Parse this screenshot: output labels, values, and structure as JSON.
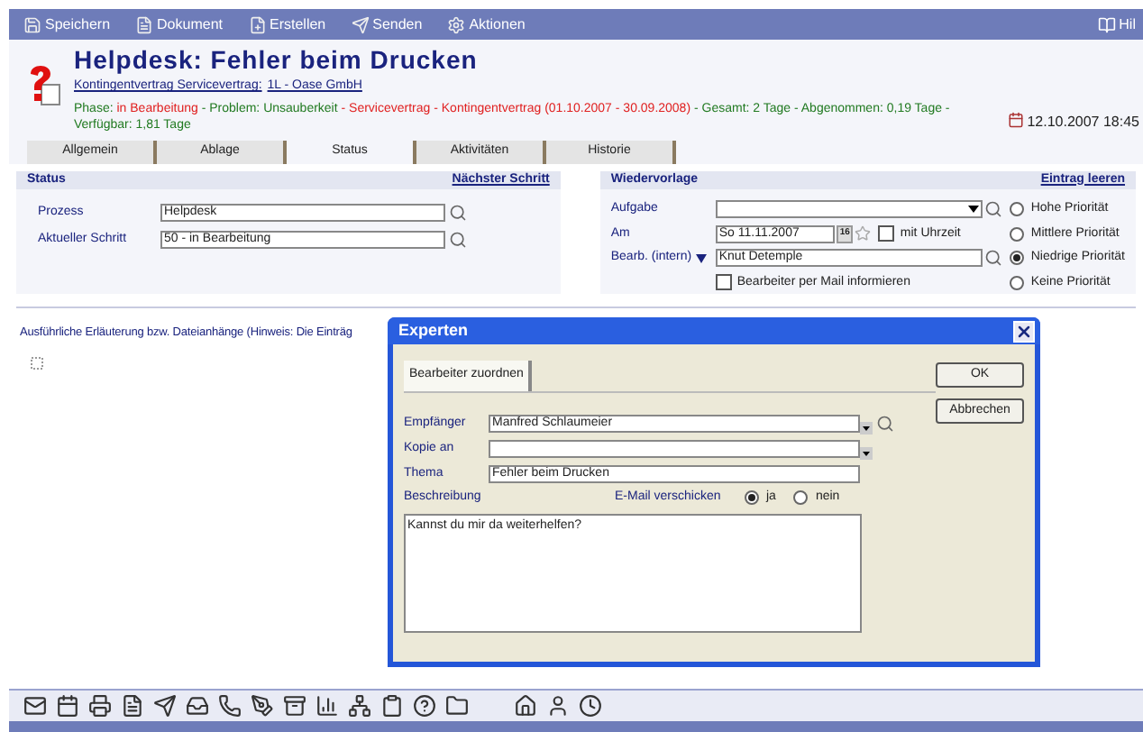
{
  "toolbar": {
    "buttons": [
      "Speichern",
      "Dokument",
      "Erstellen",
      "Senden",
      "Aktionen"
    ],
    "help": "Hil"
  },
  "header": {
    "title": "Helpdesk: Fehler beim Drucken",
    "contract_link": "Kontingentvertrag Servicevertrag:",
    "company_link": "1L - Oase GmbH",
    "info": [
      {
        "text": "Phase:",
        "color": "#217a21"
      },
      {
        "text": "in Bearbeitung",
        "color": "#e02020"
      },
      {
        "text": "- Problem: Unsauberkeit",
        "color": "#217a21"
      },
      {
        "text": "- Servicevertrag - Kontingentvertrag (01.10.2007 - 30.09.2008)",
        "color": "#e02020"
      },
      {
        "text": "- Gesamt: 2 Tage - Abgenommen: 0,19 Tage - Verfügbar: 1,81 Tage",
        "color": "#217a21"
      }
    ],
    "date": "12.10.2007 18:45"
  },
  "tabs": [
    {
      "label": "Allgemein",
      "selected": false
    },
    {
      "label": "Ablage",
      "selected": false
    },
    {
      "label": "Status",
      "selected": true
    },
    {
      "label": "Aktivitäten",
      "selected": false
    },
    {
      "label": "Historie",
      "selected": false
    }
  ],
  "status": {
    "title": "Status",
    "link": "Nächster Schritt",
    "fields": [
      {
        "label": "Prozess",
        "value": "Helpdesk"
      },
      {
        "label": "Aktueller Schritt",
        "value": "50 - in Bearbeitung"
      }
    ]
  },
  "wiedervorlage": {
    "title": "Wiedervorlage",
    "link": "Eintrag leeren",
    "aufgabe_label": "Aufgabe",
    "am_label": "Am",
    "am_value": "So 11.11.2007",
    "calendar_day": "16",
    "mit_uhrzeit": {
      "label": "mit Uhrzeit",
      "checked": false
    },
    "bearb_label": "Bearb. (intern)",
    "bearb_value": "Knut Detemple",
    "mail": {
      "label": "Bearbeiter per Mail informieren",
      "checked": false
    },
    "priorities": [
      {
        "label": "Hohe Priorität",
        "selected": false
      },
      {
        "label": "Mittlere Priorität",
        "selected": false
      },
      {
        "label": "Niedrige Priorität",
        "selected": true
      },
      {
        "label": "Keine Priorität",
        "selected": false
      }
    ]
  },
  "description_label": "Ausführliche Erläuterung bzw. Dateianhänge (Hinweis: Die Einträg",
  "dialog": {
    "title": "Experten",
    "tab": {
      "label": "Bearbeiter zuordnen",
      "selected": true
    },
    "buttons": [
      "OK",
      "Abbrechen"
    ],
    "empfaenger": {
      "label": "Empfänger",
      "value": "Manfred Schlaumeier"
    },
    "kopie": {
      "label": "Kopie an"
    },
    "thema": {
      "label": "Thema",
      "value": "Fehler beim Drucken"
    },
    "beschreibung_label": "Beschreibung",
    "email_label": "E-Mail verschicken",
    "email_options": [
      {
        "label": "ja",
        "selected": true
      },
      {
        "label": "nein",
        "selected": false
      }
    ],
    "text": "Kannst du mir da weiterhelfen?"
  }
}
